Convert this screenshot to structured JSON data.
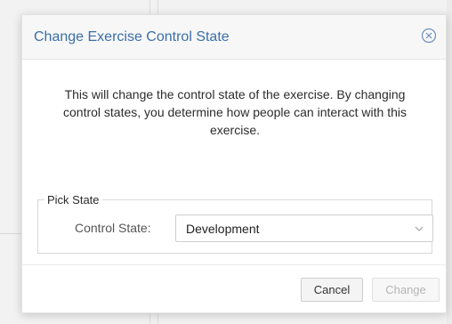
{
  "dialog": {
    "title": "Change Exercise Control State",
    "message": "This will change the control state of the exercise. By changing control states, you determine how people can interact with this exercise.",
    "fieldset": {
      "legend": "Pick State",
      "control_state_label": "Control State:",
      "control_state_value": "Development"
    },
    "buttons": {
      "cancel_label": "Cancel",
      "change_label": "Change",
      "change_enabled": false
    }
  },
  "colors": {
    "title": "#3a6fa8",
    "close_icon": "#6f8fbf",
    "disabled_text": "#b5b5b5"
  },
  "icons": {
    "close": "circle-x-icon",
    "dropdown": "chevron-down-icon"
  }
}
